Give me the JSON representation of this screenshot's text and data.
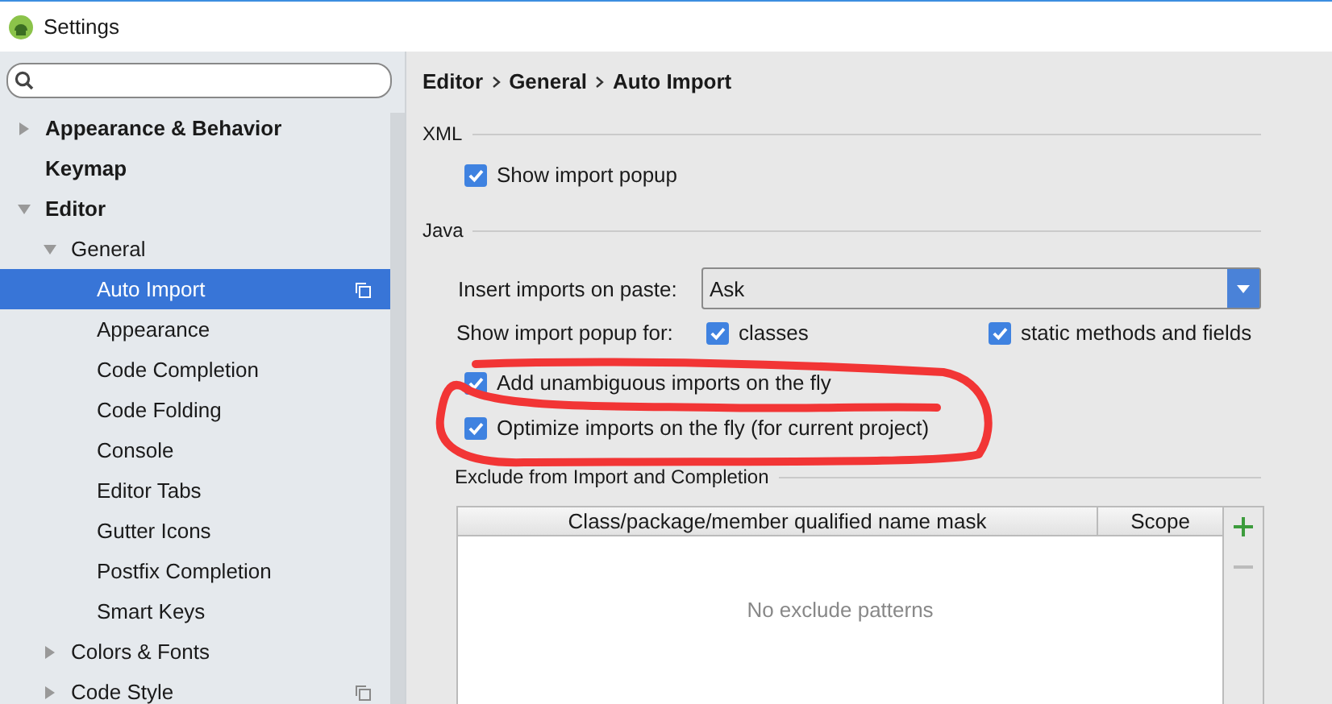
{
  "window": {
    "title": "Settings"
  },
  "sidebar": {
    "items": [
      {
        "label": "Appearance & Behavior",
        "expanded": false,
        "selected": false,
        "project": false
      },
      {
        "label": "Keymap",
        "selected": false,
        "project": false
      },
      {
        "label": "Editor",
        "expanded": true,
        "selected": false,
        "project": false,
        "children": [
          {
            "label": "General",
            "expanded": true,
            "selected": false,
            "project": false,
            "children": [
              {
                "label": "Auto Import",
                "selected": true,
                "project": true
              },
              {
                "label": "Appearance",
                "selected": false,
                "project": false
              },
              {
                "label": "Code Completion",
                "selected": false,
                "project": false
              },
              {
                "label": "Code Folding",
                "selected": false,
                "project": false
              },
              {
                "label": "Console",
                "selected": false,
                "project": false
              },
              {
                "label": "Editor Tabs",
                "selected": false,
                "project": false
              },
              {
                "label": "Gutter Icons",
                "selected": false,
                "project": false
              },
              {
                "label": "Postfix Completion",
                "selected": false,
                "project": false
              },
              {
                "label": "Smart Keys",
                "selected": false,
                "project": false
              }
            ]
          },
          {
            "label": "Colors & Fonts",
            "expanded": false,
            "selected": false,
            "project": false
          },
          {
            "label": "Code Style",
            "expanded": false,
            "selected": false,
            "project": true
          }
        ]
      }
    ]
  },
  "breadcrumb": [
    "Editor",
    "General",
    "Auto Import"
  ],
  "xml": {
    "title": "XML",
    "show_import_popup": {
      "label": "Show import popup",
      "checked": true
    }
  },
  "java": {
    "title": "Java",
    "insert_imports": {
      "label": "Insert imports on paste:",
      "value": "Ask"
    },
    "show_popup_for": {
      "label": "Show import popup for:",
      "options": [
        {
          "label": "classes",
          "checked": true
        },
        {
          "label": "static methods and fields",
          "checked": true
        }
      ]
    },
    "options": [
      {
        "label": "Add unambiguous imports on the fly",
        "checked": true
      },
      {
        "label": "Optimize imports on the fly (for current project)",
        "checked": true
      }
    ]
  },
  "exclude": {
    "title": "Exclude from Import and Completion",
    "columns": [
      "Class/package/member qualified name mask",
      "Scope"
    ],
    "empty_text": "No exclude patterns",
    "toolbar": [
      {
        "kind": "add",
        "disabled": false
      },
      {
        "kind": "remove",
        "disabled": true
      }
    ]
  }
}
